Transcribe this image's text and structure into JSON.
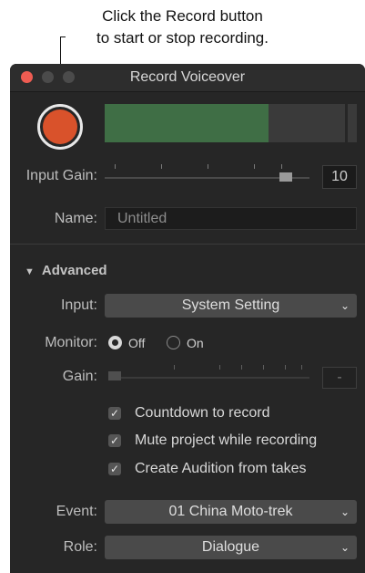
{
  "callout": {
    "line1": "Click the Record button",
    "line2": "to start or stop recording."
  },
  "window": {
    "title": "Record Voiceover"
  },
  "meter": {
    "level": 0.68
  },
  "input_gain": {
    "label": "Input Gain:",
    "value": "10",
    "level": 0.91
  },
  "name": {
    "label": "Name:",
    "value": "Untitled"
  },
  "advanced": {
    "label": "Advanced",
    "expanded": true
  },
  "input": {
    "label": "Input:",
    "value": "System Setting"
  },
  "monitor": {
    "label": "Monitor:",
    "off_label": "Off",
    "on_label": "On",
    "selected": "Off"
  },
  "gain": {
    "label": "Gain:",
    "value": "-",
    "level": 0.0
  },
  "checkboxes": [
    {
      "label": "Countdown to record",
      "checked": true
    },
    {
      "label": "Mute project while recording",
      "checked": true
    },
    {
      "label": "Create Audition from takes",
      "checked": true
    }
  ],
  "event": {
    "label": "Event:",
    "value": "01 China Moto-trek"
  },
  "role": {
    "label": "Role:",
    "value": "Dialogue"
  },
  "icons": {
    "checkmark": "✓",
    "chevron": "⌄",
    "disclosure": "▼"
  },
  "colors": {
    "record": "#d9522b",
    "meter_fill": "#3f6e45",
    "window_bg": "#262626"
  }
}
